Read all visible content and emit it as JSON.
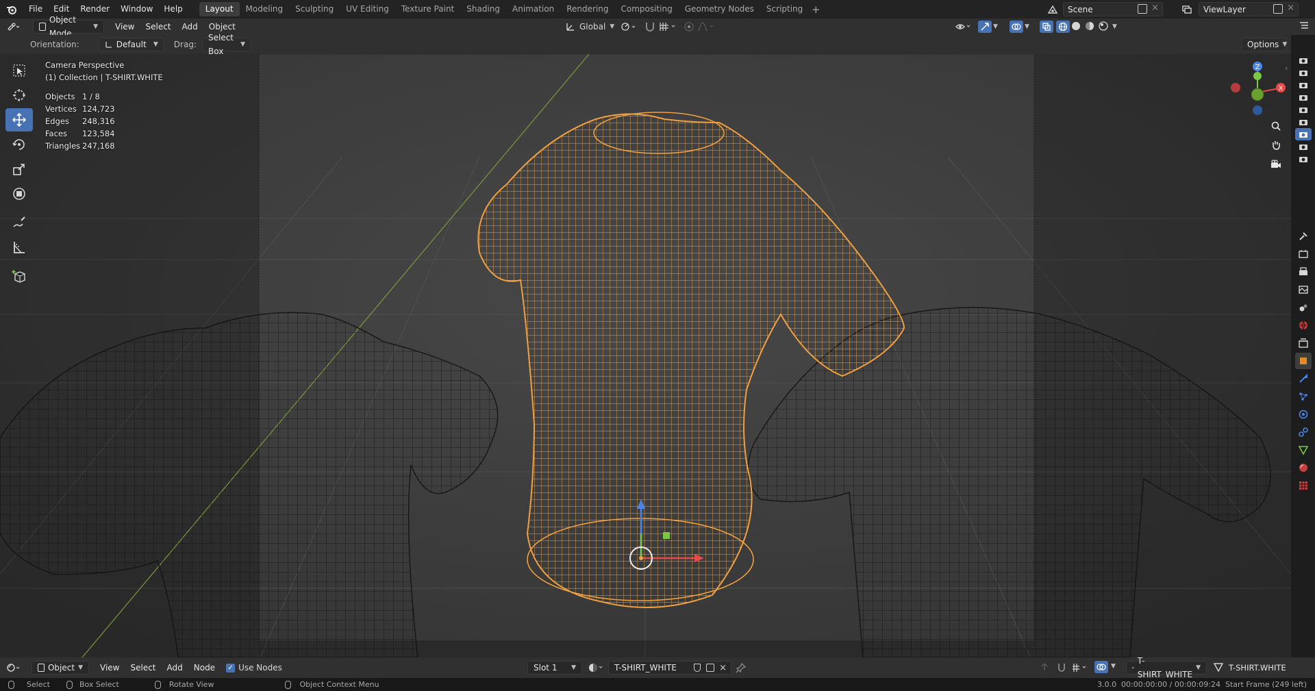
{
  "topbar": {
    "menus": [
      "File",
      "Edit",
      "Render",
      "Window",
      "Help"
    ],
    "workspaces": [
      "Layout",
      "Modeling",
      "Sculpting",
      "UV Editing",
      "Texture Paint",
      "Shading",
      "Animation",
      "Rendering",
      "Compositing",
      "Geometry Nodes",
      "Scripting"
    ],
    "add_symbol": "+",
    "scene": "Scene",
    "view_layer": "ViewLayer"
  },
  "header": {
    "mode": "Object Mode",
    "menus": [
      "View",
      "Select",
      "Add",
      "Object"
    ],
    "transform_orientation": "Global"
  },
  "tool_settings": {
    "orientation_label": "Orientation:",
    "orientation_value": "Default",
    "drag_label": "Drag:",
    "drag_value": "Select Box",
    "options": "Options"
  },
  "overlay": {
    "view_name": "Camera Perspective",
    "collection": "(1) Collection | T-SHIRT.WHITE",
    "stats": [
      {
        "key": "Objects",
        "value": "1 / 8"
      },
      {
        "key": "Vertices",
        "value": "124,723"
      },
      {
        "key": "Edges",
        "value": "248,316"
      },
      {
        "key": "Faces",
        "value": "123,584"
      },
      {
        "key": "Triangles",
        "value": "247,168"
      }
    ]
  },
  "gizmo": {
    "z": "Z",
    "y": "Y",
    "x": "X"
  },
  "bottom_header": {
    "editor_mode": "Object",
    "menus": [
      "View",
      "Select",
      "Add",
      "Node"
    ],
    "use_nodes_label": "Use Nodes",
    "use_nodes_checked": true,
    "slot": "Slot 1",
    "material": "T-SHIRT_WHITE",
    "material_right": "T-SHIRT_WHITE",
    "object_right": "T-SHIRT.WHITE"
  },
  "statusbar": {
    "select": "Select",
    "box_select": "Box Select",
    "rotate_view": "Rotate View",
    "context_menu": "Object Context Menu",
    "info": "3.0.0  00:00:00:00 / 00:00:09:24  Start Frame (249 left)"
  },
  "colors": {
    "accent": "#4772b3",
    "selected_wire": "#f0a040",
    "unselected_wire": "#101010",
    "viewport_bg": "#3c3c3c"
  }
}
